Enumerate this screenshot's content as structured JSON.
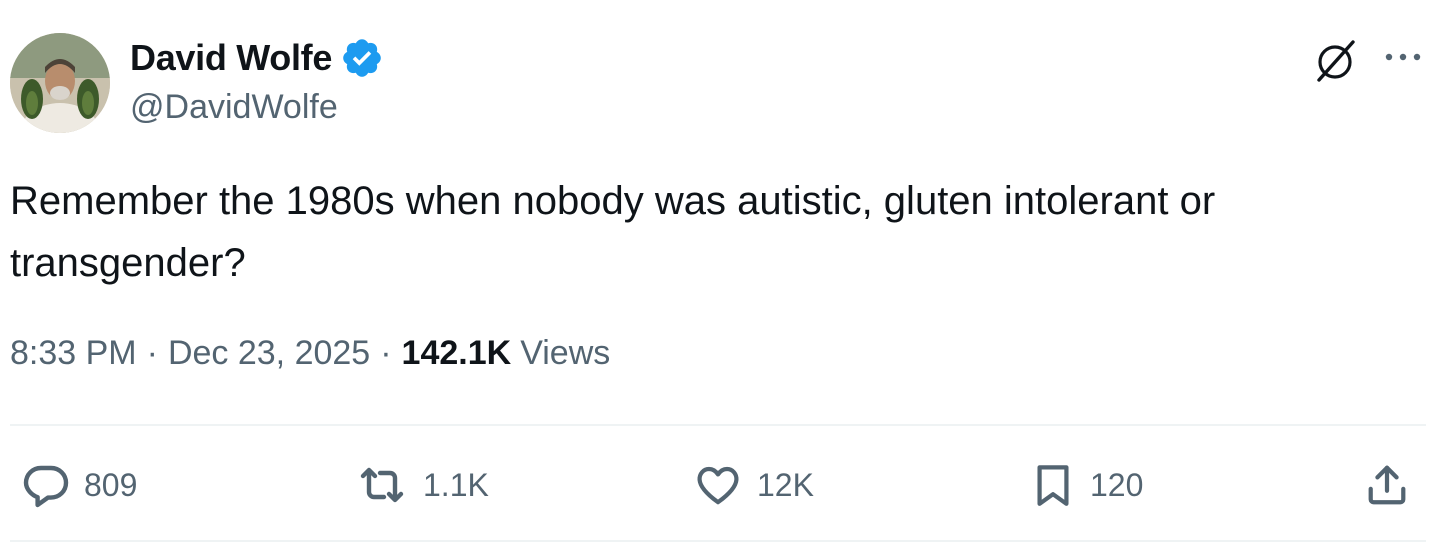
{
  "author": {
    "display_name": "David Wolfe",
    "handle": "@DavidWolfe",
    "verified": true,
    "verified_color": "#1d9bf0"
  },
  "tweet": {
    "text": "Remember the 1980s when nobody was autistic, gluten intolerant or transgender?",
    "time": "8:33 PM",
    "date": "Dec 23, 2025",
    "separator": "·",
    "views_count": "142.1K",
    "views_label": "Views"
  },
  "actions": {
    "replies": "809",
    "reposts": "1.1K",
    "likes": "12K",
    "bookmarks": "120"
  },
  "icons": {
    "header": [
      "grok-icon",
      "more-icon"
    ],
    "action_bar": [
      "reply-icon",
      "repost-icon",
      "like-icon",
      "bookmark-icon",
      "share-icon"
    ]
  },
  "colors": {
    "text_primary": "#0f1419",
    "text_secondary": "#536471",
    "divider": "#eff3f4"
  }
}
